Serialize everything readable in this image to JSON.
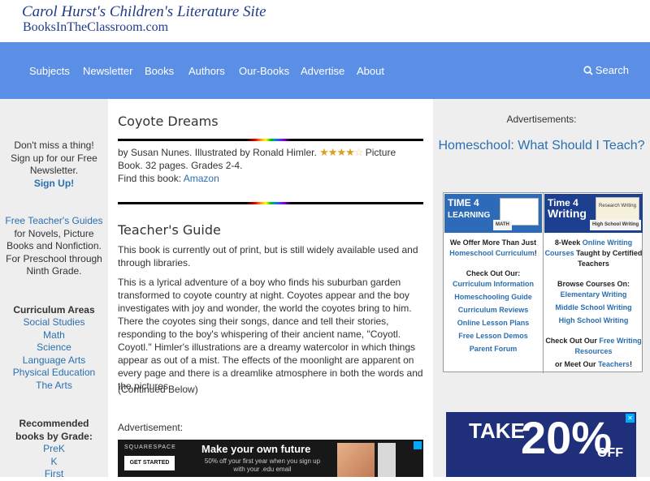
{
  "site": {
    "title": "Carol Hurst's Children's Literature Site",
    "subtitle": "BooksInTheClassroom.com"
  },
  "nav": {
    "items": [
      "Subjects",
      "Newsletter",
      "Books",
      "Authors",
      "Our-Books",
      "Advertise",
      "About"
    ],
    "search_label": "Search",
    "search_icon": "search-icon",
    "bg_color": "#5b8fe6"
  },
  "left": {
    "newsletter_text": "Don't miss a thing! Sign up for our Free Newsletter.",
    "signup_link": "Sign Up!",
    "guides_link": "Free Teacher's Guides",
    "guides_text": "for Novels, Picture Books and Nonfiction. For Preschool through Ninth Grade.",
    "curriculum_heading": "Curriculum Areas",
    "curriculum_items": [
      "Social Studies",
      "Math",
      "Science",
      "Language Arts",
      "Physical Education",
      "The Arts"
    ],
    "grade_heading": "Recommended books by Grade:",
    "grade_items": [
      "PreK",
      "K",
      "First"
    ]
  },
  "book": {
    "title": "Coyote Dreams",
    "byline_pre": "by Susan Nunes. Illustrated by Ronald Himler.",
    "rating": 4,
    "rating_max": 5,
    "byline_post": "Picture Book. 32 pages. Grades 2-4.",
    "find_label": "Find this book:",
    "find_link": "Amazon"
  },
  "guide": {
    "heading": "Teacher's Guide",
    "para1": "This book is currently out of print, but is still widely available used and through libraries.",
    "para2": "This is a lyrical adventure of a boy who finds his suburban garden transformed to coyote country at night. Coyotes appear and the boy investigates with joy and wonder, the world the coyotes bring to him. There the coyotes sing their songs, dance and tell their stories, responding to the boy's whispering of their ancient name, \"Coyotl. Coyotl.\" Himler's illustrations are a dreamy watercolor in which things appear as out of a mist. The effects of the moonlight are apparent on every page and there is a dreamlike atmosphere in both the words and the pictures.",
    "continued": "(Continued Below)",
    "advert_label": "Advertisement:"
  },
  "main_ad": {
    "brand": "SQUARESPACE",
    "button": "GET STARTED",
    "headline": "Make your own future",
    "body": "50% off your first year when you sign up with your .edu email"
  },
  "right": {
    "ads_label": "Advertisements:",
    "headline": "Homeschool: What Should I Teach?",
    "left_ad": {
      "logo_line1": "TIME 4",
      "logo_line2": "LEARNING",
      "logo_tag": "MATH",
      "intro_a": "We Offer More Than Just",
      "intro_link": "Homeschool Curriculum",
      "intro_b": "!",
      "checkout": "Check Out Our:",
      "links": [
        "Curriculum Information",
        "Homeschooling Guide",
        "Curriculum Reviews",
        "Online Lesson Plans",
        "Free Lesson Demos",
        "Parent Forum"
      ]
    },
    "right_ad": {
      "logo_line1": "Time 4",
      "logo_line2": "Writing",
      "logo_tag": "High School Writing",
      "paper_text": "Research Writing",
      "intro_a": "8-Week",
      "intro_link": "Online Writing Courses",
      "intro_b": "Taught by Certified Teachers",
      "browse": "Browse Courses On:",
      "links": [
        "Elementary Writing",
        "Middle School Writing",
        "High School Writing"
      ],
      "checkout_a": "Check Out Our",
      "checkout_link": "Free Writing Resources",
      "meet_a": "or Meet Our",
      "meet_link": "Teachers",
      "meet_b": "!"
    },
    "bottom_ad": {
      "take": "TAKE",
      "pct": "20%",
      "off": "OFF"
    }
  }
}
